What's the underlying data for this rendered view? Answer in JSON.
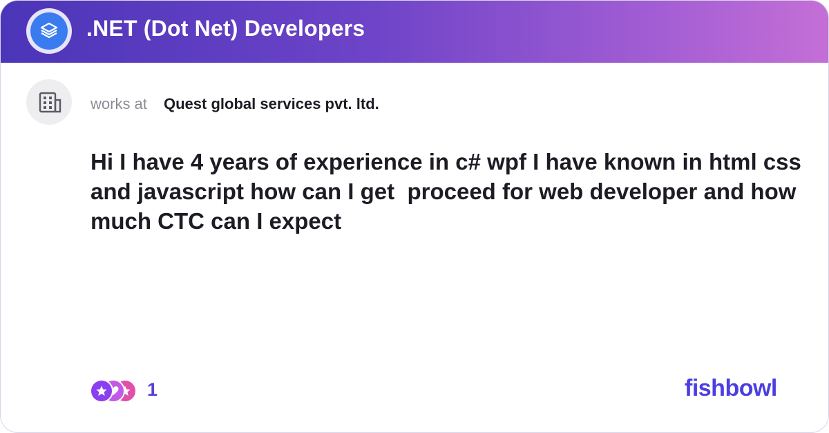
{
  "header": {
    "bowl_name": ".NET (Dot Net) Developers",
    "bowl_icon": "stacked-layers-icon",
    "colors": {
      "gradient_start": "#4b35b8",
      "gradient_end": "#c46fd6"
    }
  },
  "author": {
    "avatar_icon": "building-icon",
    "works_at_label": "works at",
    "company": "Quest global services pvt. ltd."
  },
  "post": {
    "text": "Hi I have 4 years of experience in c# wpf I have known in html css\nand javascript how can I get  proceed for web developer and how\nmuch CTC can I expect"
  },
  "footer": {
    "reaction_icons": [
      "star-reaction-icon",
      "heart-reaction-icon",
      "clap-reaction-icon"
    ],
    "reaction_count": "1",
    "logo": "fishbowl",
    "logo_color": "#4b3fe0"
  }
}
